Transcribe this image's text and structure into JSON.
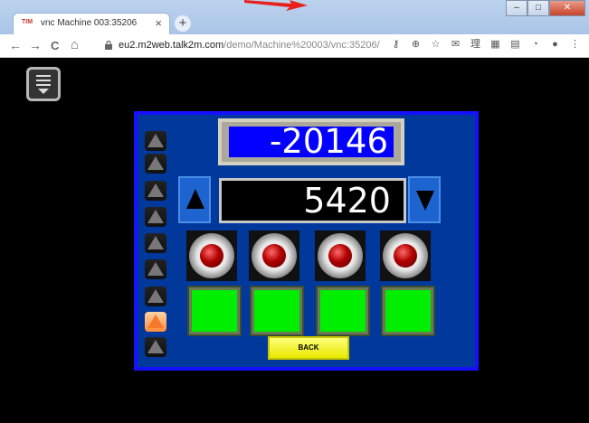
{
  "browser": {
    "tab_icon_text": "TIM",
    "tab_title": "vnc Machine 003:35206",
    "tab_close": "×",
    "new_tab": "+",
    "url_host": "eu2.m2web.talk2m.com",
    "url_path": "/demo/Machine%20003/vnc:35206/",
    "window_buttons": [
      "–",
      "□",
      "✕"
    ]
  },
  "nav": {
    "back": "←",
    "forward": "→",
    "reload": "C",
    "home": "⌂"
  },
  "toolbar_icons": [
    "key-icon",
    "zoom-icon",
    "star-icon",
    "extension-icon",
    "translate-icon",
    "image-icon",
    "puzzle-icon",
    "circle-icon",
    "account-icon",
    "more-icon"
  ],
  "toolbar_glyphs": [
    "⚷",
    "⊕",
    "☆",
    "✉",
    "理",
    "▦",
    "▤",
    "◔",
    "●",
    "⋮"
  ],
  "hmi": {
    "counter_value": "-20146",
    "setpoint_value": "5420",
    "side_buttons": 9,
    "active_side_button": 8,
    "lamps": 4,
    "status_indicators": 4,
    "back_label": "BACK",
    "colors": {
      "panel": "#00389b",
      "panel_border": "#1510ff",
      "counter_bg": "#0400ff",
      "status_on": "#00ef00",
      "back_button": "#f0f000",
      "active_arrow": "#f6782a"
    }
  }
}
